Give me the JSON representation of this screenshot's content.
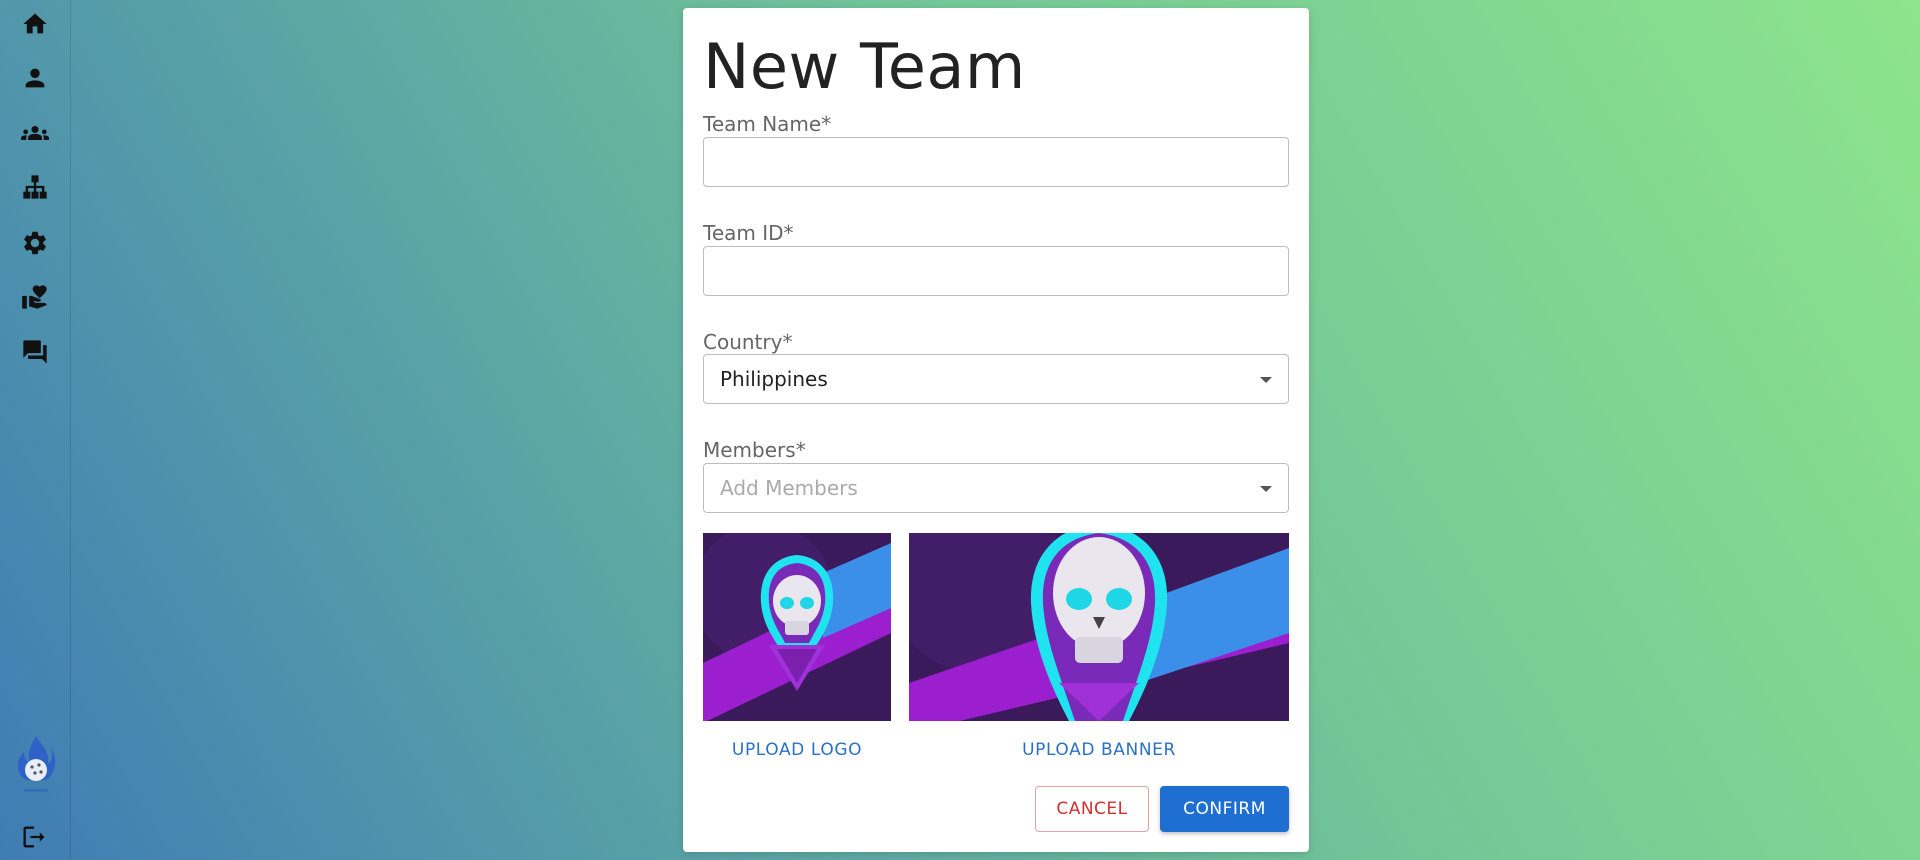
{
  "sidebar": {
    "items": [
      {
        "icon": "home-icon"
      },
      {
        "icon": "person-icon"
      },
      {
        "icon": "groups-icon"
      },
      {
        "icon": "hierarchy-icon"
      },
      {
        "icon": "gear-icon"
      },
      {
        "icon": "volunteer-heart-icon"
      },
      {
        "icon": "forum-icon"
      }
    ],
    "logout_icon": "logout-icon"
  },
  "dialog": {
    "title": "New Team",
    "fields": {
      "team_name": {
        "label": "Team Name",
        "required": "*",
        "value": ""
      },
      "team_id": {
        "label": "Team ID",
        "required": "*",
        "value": ""
      },
      "country": {
        "label": "Country",
        "required": "*",
        "value": "Philippines"
      },
      "members": {
        "label": "Members",
        "required": "*",
        "placeholder": "Add Members"
      }
    },
    "upload_logo": "UPLOAD LOGO",
    "upload_banner": "UPLOAD BANNER",
    "cancel": "CANCEL",
    "confirm": "CONFIRM"
  },
  "colors": {
    "accent": "#1e6fd1",
    "cancel": "#d32f2f",
    "link": "#2a71c4"
  }
}
